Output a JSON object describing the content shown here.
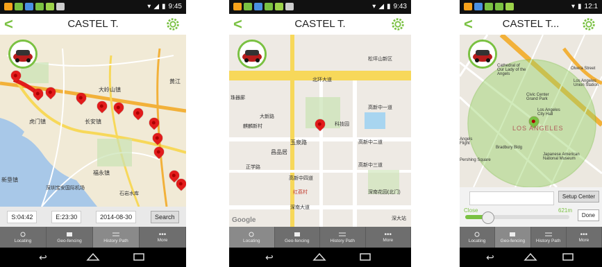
{
  "app_title": "CASTEL T.",
  "app_title_short": "CASTEL T...",
  "statusbar_times": [
    "9:45",
    "9:43",
    "12:1"
  ],
  "tabs": [
    "Locating",
    "Geo-fencing",
    "History Path",
    "More"
  ],
  "history": {
    "start": "S:04:42",
    "end": "E:23:30",
    "date": "2014-08-30",
    "search_label": "Search"
  },
  "map1_labels": {
    "town1": "大岭山镇",
    "town2": "虎门镇",
    "town3": "长安镇",
    "town4": "福永镇",
    "town5": "新垦镇",
    "airport": "深圳宝安国际机场",
    "town6": "石岩水库",
    "town7": "黄江"
  },
  "map2_labels": {
    "road1": "北环大道",
    "road2": "玉泉路",
    "place1": "珠器廊",
    "place2": "麒麟新村",
    "place3": "大新路",
    "place4": "昌品居",
    "place5": "正学路",
    "place6": "高新中四道",
    "place7": "红荔村",
    "place8": "深南大道",
    "place9": "深南花园(北门)",
    "place10": "深大站",
    "place11": "高新中二道",
    "place12": "高新中三道",
    "place13": "高新中一道",
    "place14": "科技园",
    "watermark": "Google",
    "place15": "松坪山新区"
  },
  "map3_labels": {
    "city": "LOS ANGELES",
    "place1": "Cathedral of Our Lady of the Angels",
    "place2": "Civic Center Grand Park",
    "place3": "Los Angeles City Hall",
    "place4": "Bradbury Bldg",
    "place5": "Japanese American National Museum",
    "place6": "Pershing Square",
    "place7": "Olvera Street",
    "place8": "Los Angeles Union Station",
    "place9": "Angels Flight"
  },
  "geofence": {
    "setup_label": "Setup Center",
    "close_label": "Close",
    "distance": "621m",
    "done_label": "Done"
  }
}
